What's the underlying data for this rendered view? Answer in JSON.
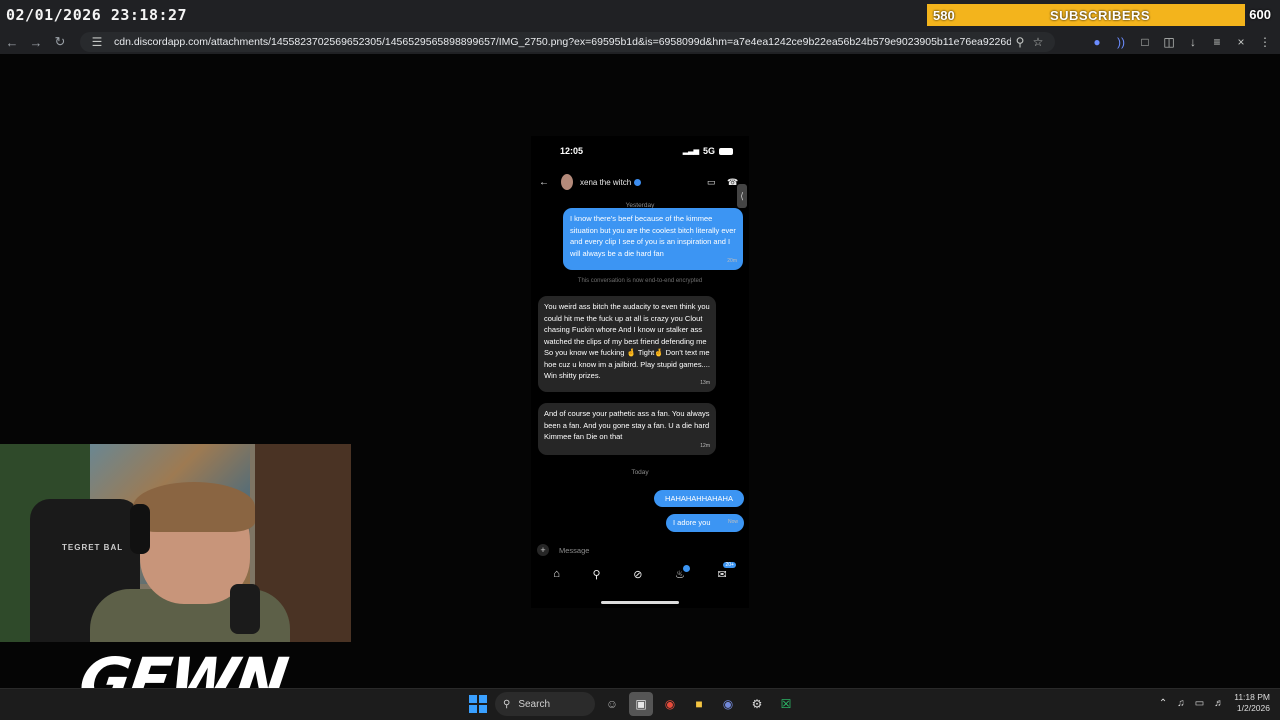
{
  "overlay": {
    "clock": "02/01/2026 23:18:27",
    "subscribers": {
      "current": "580",
      "label": "SUBSCRIBERS",
      "goal": "600"
    }
  },
  "browser": {
    "url": "cdn.discordapp.com/attachments/1455823702569652305/1456529565898899657/IMG_2750.png?ex=69595b1d&is=6958099d&hm=a7e4ea1242ce9b22ea56b24b579e9023905b11e76ea9226d5dc6eb1b6ccc1a91&"
  },
  "phone": {
    "time": "12:05",
    "network": "5G",
    "contact_name": "xena the witch",
    "day_yesterday": "Yesterday",
    "day_today": "Today",
    "encryption_note": "This conversation is now end-to-end encrypted",
    "message_placeholder": "Message",
    "messages": [
      {
        "dir": "out",
        "text": "I know there's beef because of the kimmee situation but you are the coolest bitch literally ever and every clip I see of you is an inspiration and I will always be a die hard fan",
        "time": "20m"
      },
      {
        "dir": "in",
        "text": "You weird ass bitch the audacity to even think you could hit me the fuck up at all is crazy you Clout chasing Fuckin whore And I know ur stalker ass watched the clips of my best friend defending me So you know we fucking 🤞 Tight🤞 Don't text me hoe cuz u know im a jailbird. Play stupid games.... Win shitty prizes.",
        "time": "13m"
      },
      {
        "dir": "in",
        "text": "And of course your pathetic ass a fan. You always been a fan. And you gone stay a fan. U a die hard Kimmee fan Die on that",
        "time": "12m"
      },
      {
        "dir": "out",
        "text": "HAHAHAHHAHAHA",
        "time": ""
      },
      {
        "dir": "out",
        "text": "I adore you",
        "time": "Now"
      }
    ],
    "inbox_badge": "20+"
  },
  "stream": {
    "logo_text": "GEWN",
    "chair_brand": "TEGRET BAL"
  },
  "taskbar": {
    "search_label": "Search",
    "time": "11:18 PM",
    "date": "1/2/2026"
  }
}
